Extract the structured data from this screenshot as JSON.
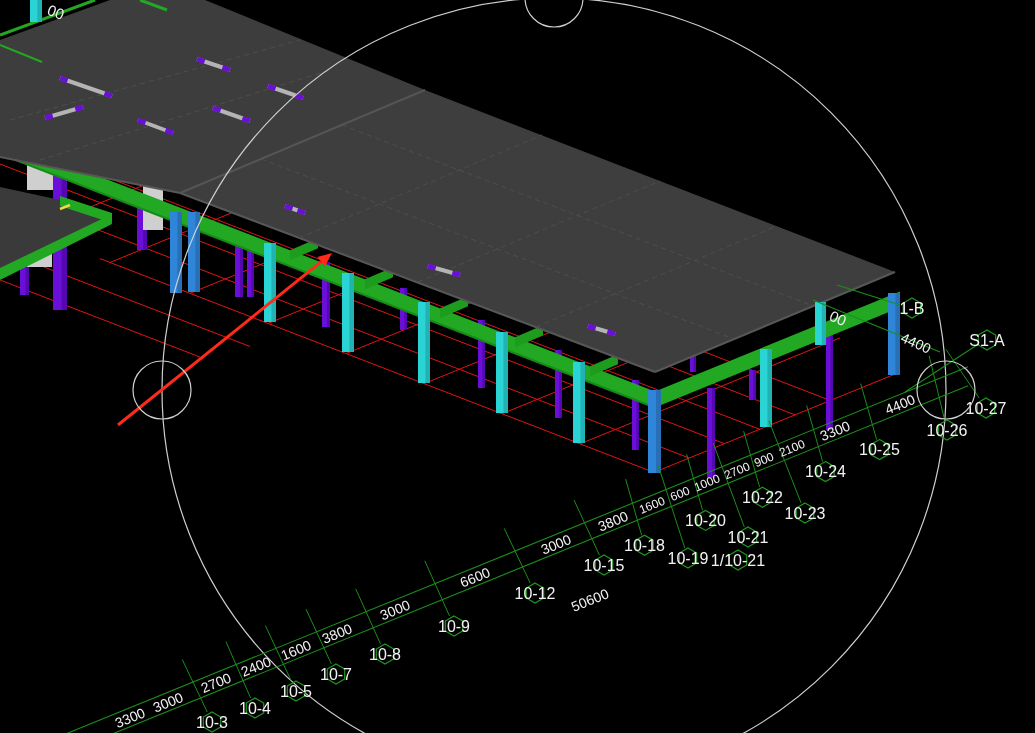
{
  "dimension_labels": [
    "3300",
    "3000",
    "2700",
    "2400",
    "1600",
    "3800",
    "3000",
    "6600",
    "3000",
    "3800",
    "1600",
    "600",
    "1000",
    "2700",
    "900",
    "2100",
    "3300",
    "4400"
  ],
  "total_dimension": "50600",
  "axis_labels": [
    "10-3",
    "10-4",
    "10-5",
    "10-7",
    "10-8",
    "10-9",
    "10-12",
    "10-15",
    "10-18",
    "10-19",
    "10-20",
    "10-21",
    "1/10-21",
    "10-22",
    "10-23",
    "10-24",
    "10-25",
    "10-26",
    "10-27"
  ],
  "side_axis_labels": [
    "S1-A",
    "1-B"
  ],
  "side_dimension_label": "4400",
  "cut_dimension_labels": [
    "00",
    "00"
  ]
}
